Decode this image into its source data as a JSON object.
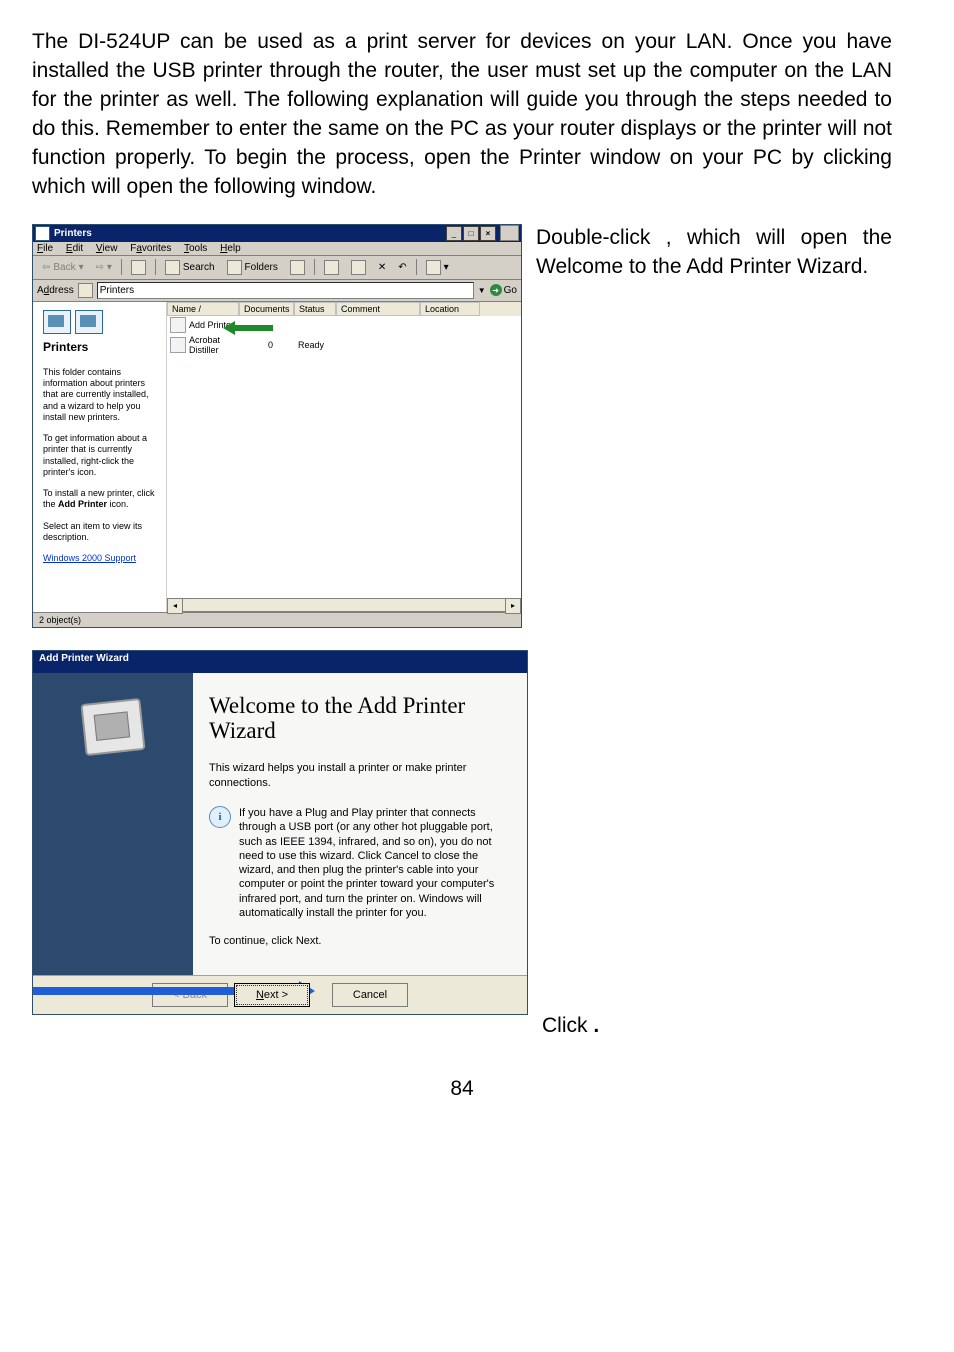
{
  "text": {
    "para1_a": "The DI-524UP can be used as a print server for devices on your LAN. Once you have installed the USB printer through the router, the user must set up the computer on the LAN for the printer as well. The following explanation will guide you through the steps needed to do this. Remember to enter the same ",
    "para1_b": " on the PC as your router displays or the printer will not function properly. To begin the process, open the Printer window on your PC by clicking ",
    "para1_c": " which will open the following window.",
    "right1_a": "Double-click ",
    "right1_b": ", which will open the Welcome to the Add Printer Wizard.",
    "click": "Click ",
    "dot": ".",
    "pagenum": "84"
  },
  "printers_window": {
    "title": "Printers",
    "btn_min": "_",
    "btn_max": "□",
    "btn_close": "×",
    "menus": [
      "File",
      "Edit",
      "View",
      "Favorites",
      "Tools",
      "Help"
    ],
    "tb": {
      "back": "Back",
      "search": "Search",
      "folders": "Folders"
    },
    "addr_label": "Address",
    "addr_value": "Printers",
    "go": "Go",
    "left_title": "Printers",
    "left_p1": "This folder contains information about printers that are currently installed, and a wizard to help you install new printers.",
    "left_p2": "To get information about a printer that is currently installed, right-click the printer's icon.",
    "left_p3_a": "To install a new printer, click the ",
    "left_p3_b": "Add Printer",
    "left_p3_c": " icon.",
    "left_p4": "Select an item to view its description.",
    "left_link": "Windows 2000 Support",
    "cols": [
      "Name  /",
      "Documents",
      "Status",
      "Comment",
      "Location"
    ],
    "rows": [
      {
        "name": "Add Printer",
        "docs": "",
        "status": ""
      },
      {
        "name": "Acrobat Distiller",
        "docs": "0",
        "status": "Ready"
      }
    ],
    "status": "2 object(s)"
  },
  "wizard": {
    "title": "Add Printer Wizard",
    "h": "Welcome to the Add Printer Wizard",
    "p1": "This wizard helps you install a printer or make printer connections.",
    "info": "If you have a Plug and Play printer that connects through a USB port (or any other hot pluggable port, such as IEEE 1394, infrared, and so on), you do not need to use this wizard. Click Cancel to close the wizard, and then plug the printer's cable into your computer or point the printer toward your computer's infrared port, and turn the printer on. Windows will automatically install the printer for you.",
    "p2": "To continue, click Next.",
    "btn_back": "< Back",
    "btn_next": "Next >",
    "btn_cancel": "Cancel"
  }
}
